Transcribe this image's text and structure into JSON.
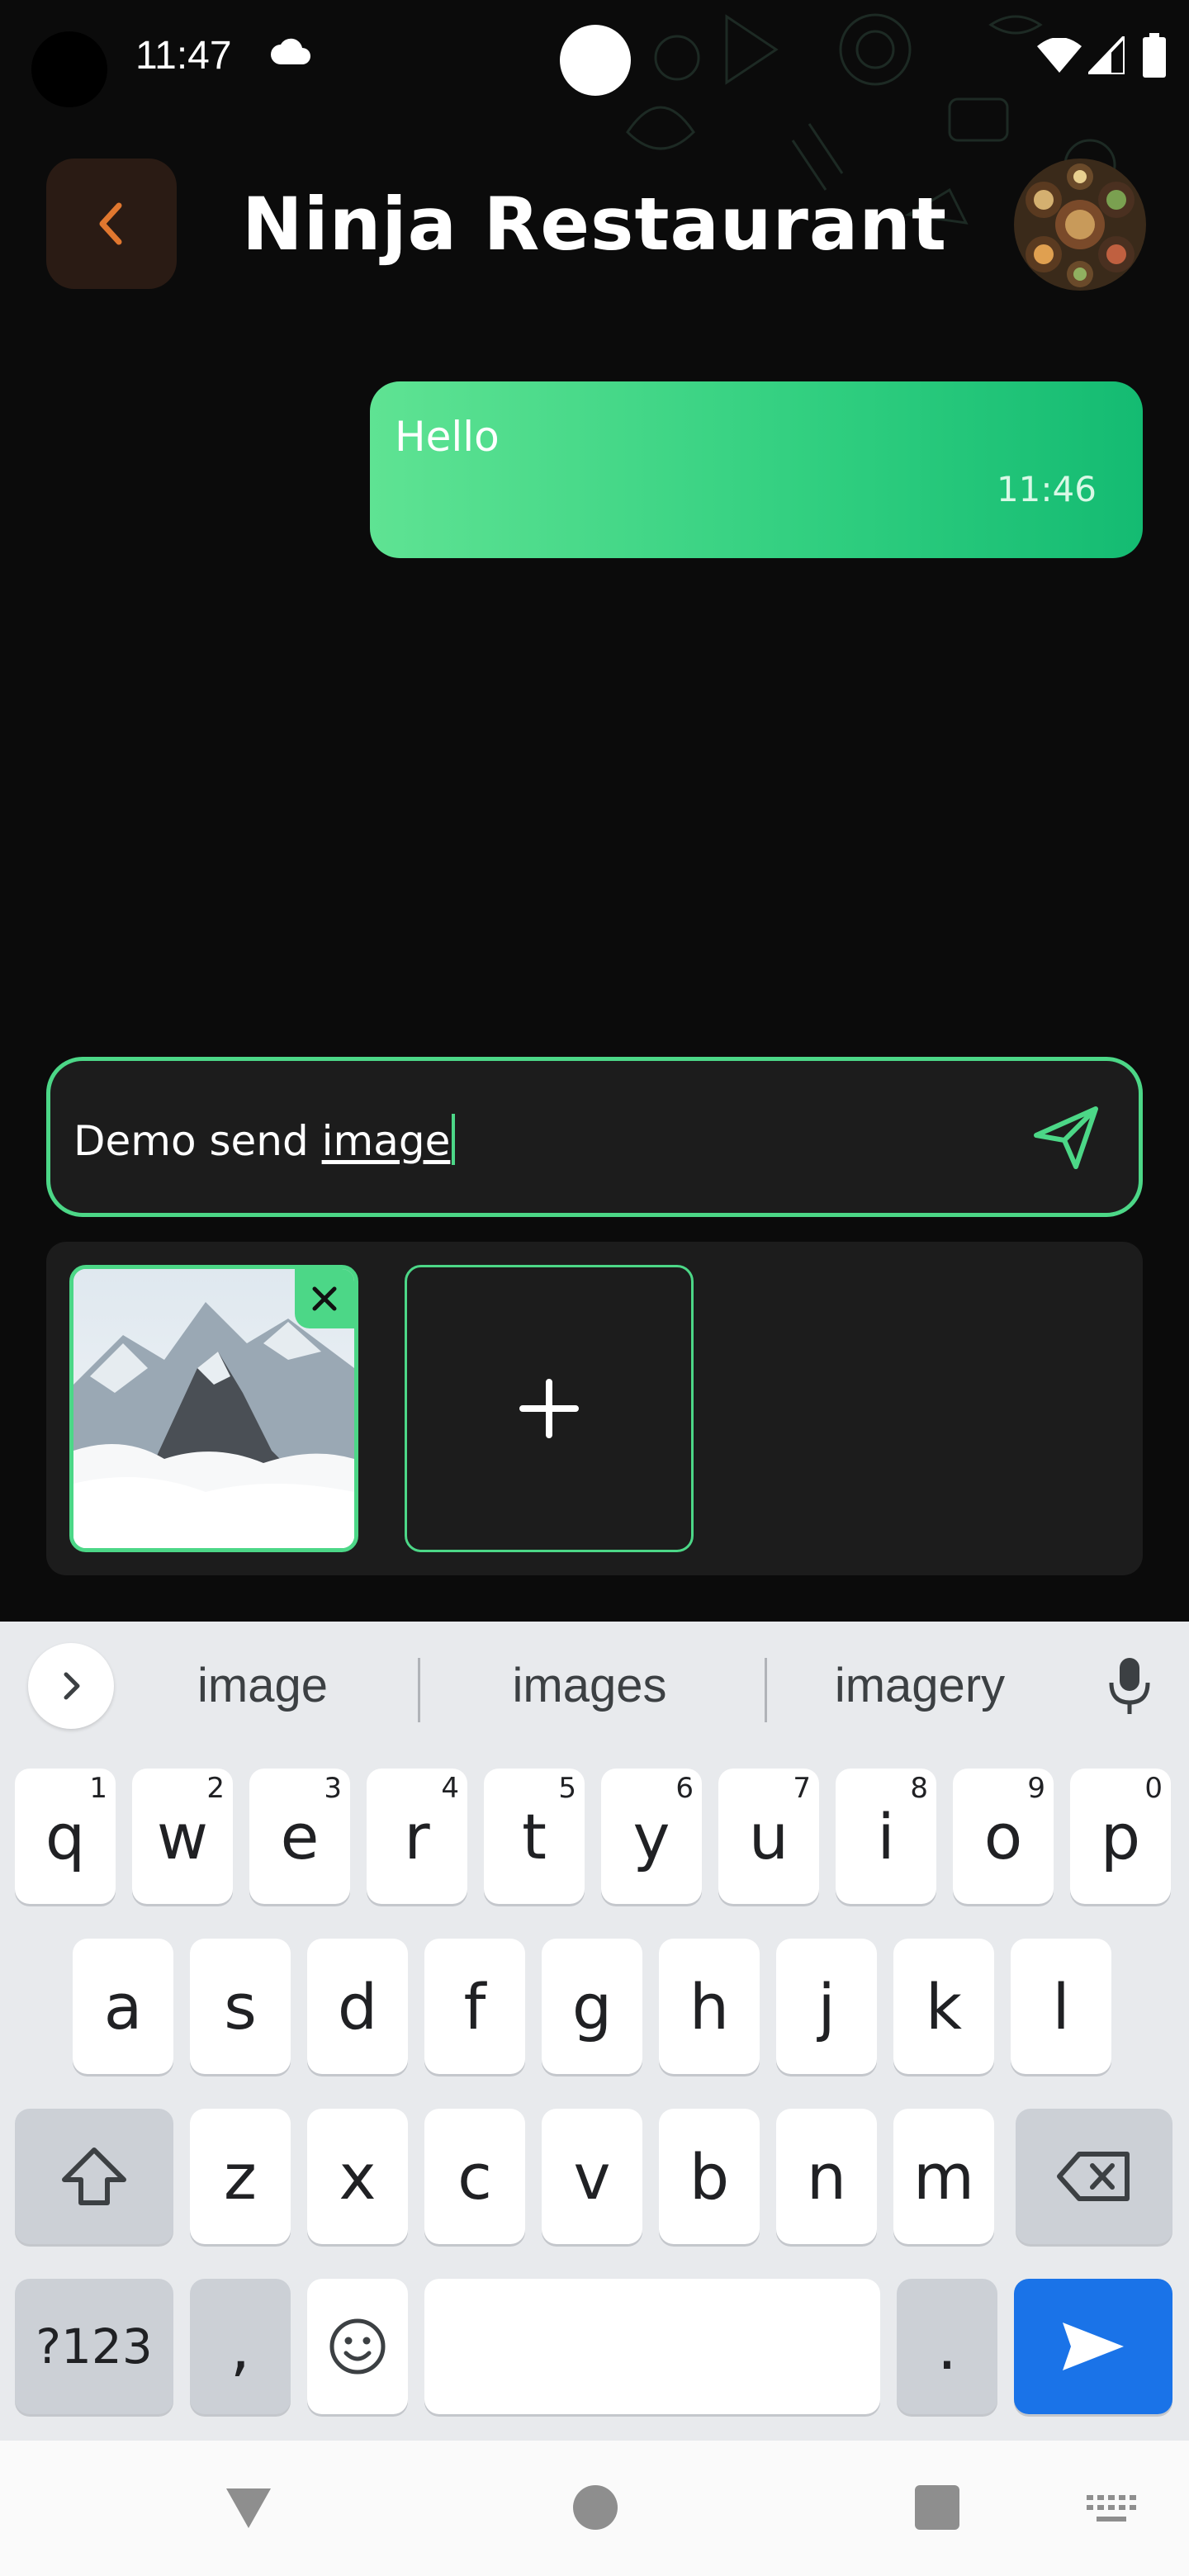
{
  "status_bar": {
    "time": "11:47",
    "icons": [
      "cloud-icon",
      "wifi-icon",
      "signal-icon",
      "battery-icon"
    ]
  },
  "header": {
    "title": "Ninja Restaurant",
    "back_icon": "chevron-left-icon",
    "accent_color": "#e0772f"
  },
  "messages": [
    {
      "text": "Hello",
      "time": "11:46",
      "outgoing": true
    }
  ],
  "composer": {
    "text_plain": "Demo send ",
    "text_underlined": "image",
    "send_icon": "send-icon"
  },
  "attachments": {
    "items": [
      {
        "type": "image",
        "subject": "snowy-mountain",
        "remove_icon": "close-icon"
      }
    ],
    "add_icon": "plus-icon"
  },
  "keyboard": {
    "suggestions": [
      "image",
      "images",
      "imagery"
    ],
    "row1": [
      {
        "k": "q",
        "h": "1"
      },
      {
        "k": "w",
        "h": "2"
      },
      {
        "k": "e",
        "h": "3"
      },
      {
        "k": "r",
        "h": "4"
      },
      {
        "k": "t",
        "h": "5"
      },
      {
        "k": "y",
        "h": "6"
      },
      {
        "k": "u",
        "h": "7"
      },
      {
        "k": "i",
        "h": "8"
      },
      {
        "k": "o",
        "h": "9"
      },
      {
        "k": "p",
        "h": "0"
      }
    ],
    "row2": [
      "a",
      "s",
      "d",
      "f",
      "g",
      "h",
      "j",
      "k",
      "l"
    ],
    "row3": [
      "z",
      "x",
      "c",
      "v",
      "b",
      "n",
      "m"
    ],
    "symbols_label": "?123",
    "comma_label": ",",
    "period_label": "."
  },
  "colors": {
    "brand_green": "#4cd787",
    "bubble_gradient_start": "#5fe393",
    "bubble_gradient_end": "#14bb72",
    "keyboard_action_blue": "#1a73e8"
  }
}
